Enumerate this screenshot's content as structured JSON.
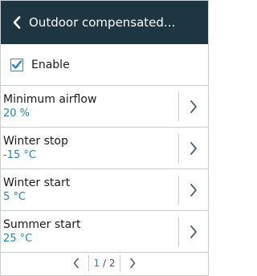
{
  "header": {
    "title": "Outdoor compensated..."
  },
  "enable": {
    "label": "Enable",
    "checked": true
  },
  "items": [
    {
      "label": "Minimum airflow",
      "value": "20 %"
    },
    {
      "label": "Winter stop",
      "value": "-15 °C"
    },
    {
      "label": "Winter start",
      "value": "5 °C"
    },
    {
      "label": "Summer start",
      "value": "25 °C"
    }
  ],
  "pager": {
    "current": "1",
    "separator": "/",
    "total": "2"
  },
  "colors": {
    "header_bg": "#1d3641",
    "accent": "#1f86c6"
  }
}
